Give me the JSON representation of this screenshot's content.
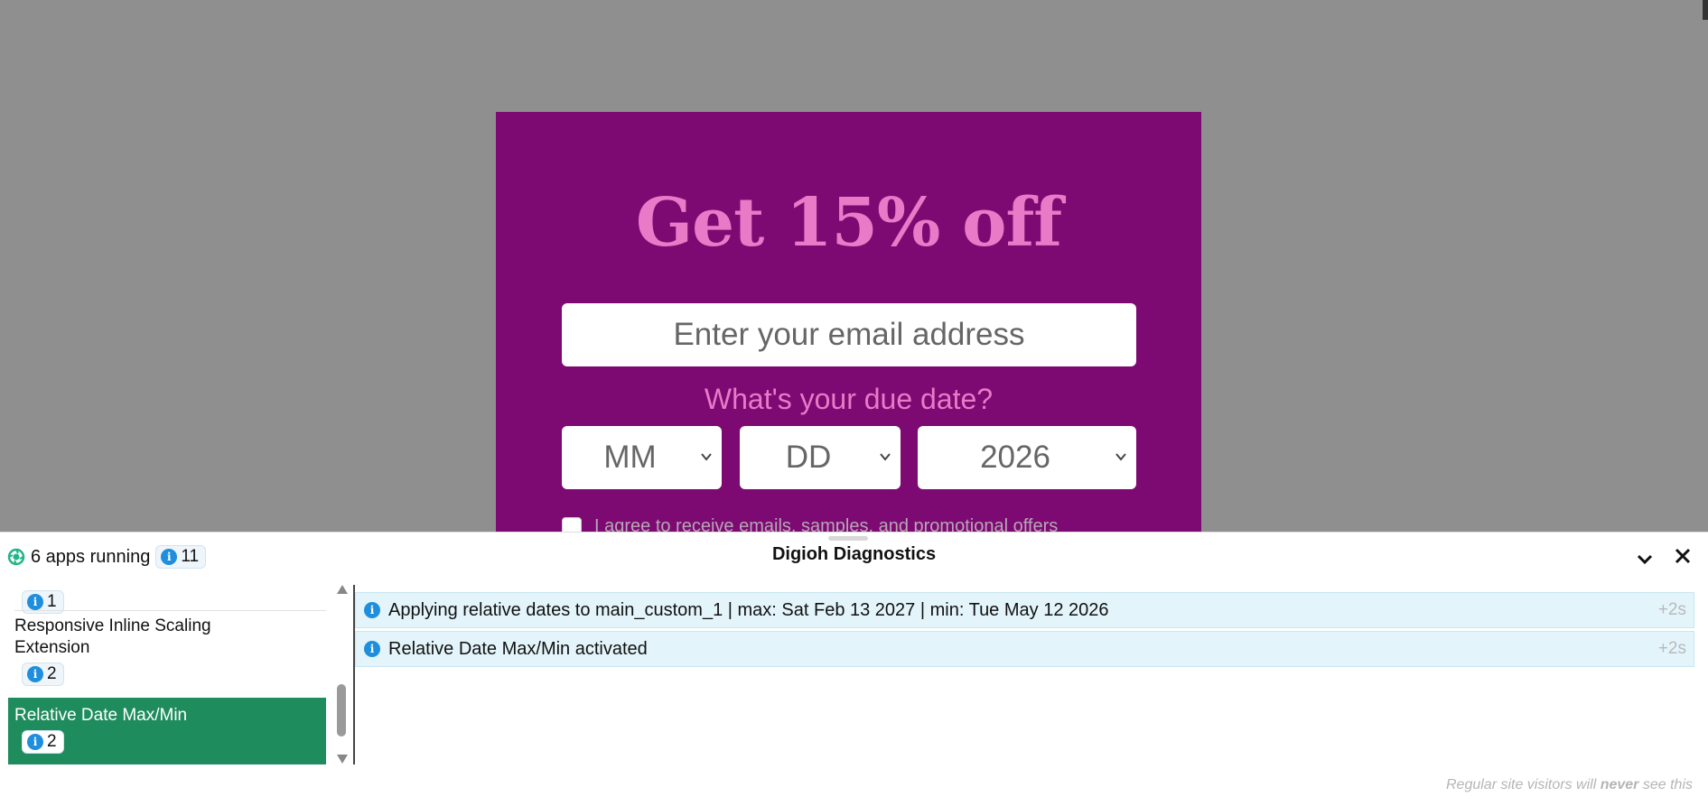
{
  "popup": {
    "title": "Get 15% off",
    "email_placeholder": "Enter your email address",
    "due_label": "What's your due date?",
    "month_value": "MM",
    "day_value": "DD",
    "year_value": "2026",
    "agree_text": "I agree to receive emails, samples, and promotional offers",
    "background_color": "#7d0a72",
    "accent_color": "#e87ac8"
  },
  "diagnostics": {
    "apps_running_label": "6 apps running",
    "total_info_count": "11",
    "title": "Digioh Diagnostics",
    "apps": [
      {
        "name": "",
        "info_count": "1"
      },
      {
        "name": "Responsive Inline Scaling Extension",
        "info_count": "2"
      },
      {
        "name": "Relative Date Max/Min",
        "info_count": "2",
        "active": true
      }
    ],
    "logs": [
      {
        "message": "Applying relative dates to main_custom_1 | max: Sat Feb 13 2027 | min: Tue May 12 2026",
        "time": "+2s"
      },
      {
        "message": "Relative Date Max/Min activated",
        "time": "+2s"
      }
    ],
    "footnote_pre": "Regular site visitors will ",
    "footnote_emph": "never",
    "footnote_post": " see this",
    "active_color": "#1f8c5e"
  }
}
